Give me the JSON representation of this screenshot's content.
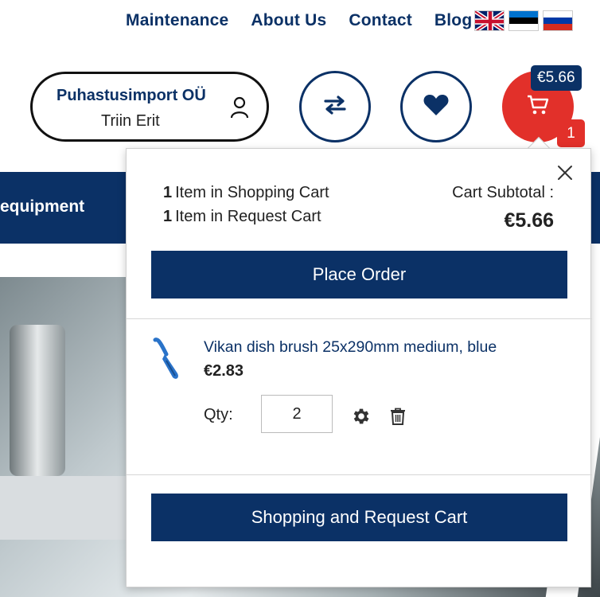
{
  "top_nav": {
    "links": [
      "Maintenance",
      "About Us",
      "Contact",
      "Blog"
    ],
    "languages": [
      "en",
      "et",
      "ru"
    ]
  },
  "account": {
    "company": "Puhastusimport OÜ",
    "user": "Triin Erit"
  },
  "header_cart": {
    "price": "€5.66",
    "count": "1"
  },
  "category_bar": {
    "visible_label": "equipment"
  },
  "minicart": {
    "shopping_cart_count": "1",
    "shopping_cart_label": "Item in Shopping Cart",
    "request_cart_count": "1",
    "request_cart_label": "Item in Request Cart",
    "subtotal_label": "Cart Subtotal :",
    "subtotal_amount": "€5.66",
    "place_order_label": "Place Order",
    "item": {
      "name": "Vikan dish brush 25x290mm medium, blue",
      "price": "€2.83",
      "qty_label": "Qty:",
      "qty_value": "2"
    },
    "view_cart_label": "Shopping and Request Cart"
  },
  "colors": {
    "brand_blue": "#0b3166",
    "accent_red": "#e2302a"
  },
  "icons": [
    "user-icon",
    "compare-icon",
    "heart-icon",
    "cart-icon",
    "close-icon",
    "gear-icon",
    "trash-icon"
  ]
}
